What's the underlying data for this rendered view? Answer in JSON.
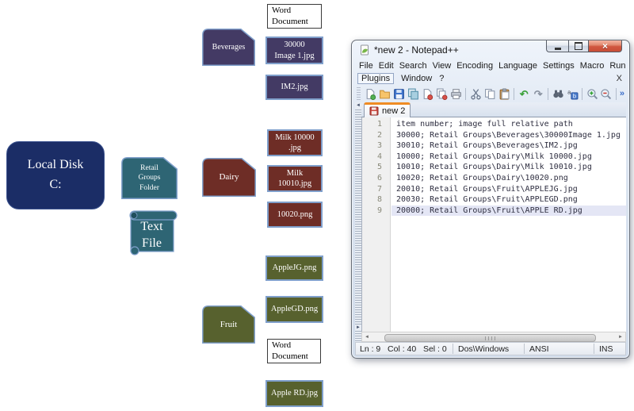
{
  "colors": {
    "root_navy": "#1b2d66",
    "teal": "#2e6574",
    "beverages_purple": "#433a64",
    "dairy_maroon": "#6e2d26",
    "fruit_olive": "#57612e",
    "filebox_border": "#7f9fcb",
    "tab_accent_orange": "#ef8b24",
    "current_line_highlight": "#e4e6f5",
    "close_button_red": "#c84e37"
  },
  "diagram": {
    "local_disk": "Local Disk\nC:",
    "retail_folder": "Retail\nGroups\nFolder",
    "text_file": "Text\nFile",
    "beverages": {
      "label": "Beverages",
      "doc": "Word\nDocument",
      "img1": "30000\nImage 1.jpg",
      "img2": "IM2.jpg"
    },
    "dairy": {
      "label": "Dairy",
      "img1": "Milk 10000\n.jpg",
      "img2": "Milk\n10010.jpg",
      "img3": "10020.png"
    },
    "fruit": {
      "label": "Fruit",
      "img1": "AppleJG.png",
      "img2": "AppleGD.png",
      "doc": "Word\nDocument",
      "img3": "Apple RD.jpg"
    }
  },
  "notepad": {
    "title": "*new 2 - Notepad++",
    "menu_row1": [
      "File",
      "Edit",
      "Search",
      "View",
      "Encoding",
      "Language",
      "Settings",
      "Macro",
      "Run"
    ],
    "menu_row2": [
      "Plugins",
      "Window",
      "?"
    ],
    "menu_close": "X",
    "toolbar_icons": [
      "new-file",
      "open-folder",
      "save",
      "save-all",
      "close-file",
      "close-all-files",
      "print",
      "cut",
      "copy",
      "paste",
      "undo",
      "redo",
      "find",
      "replace",
      "zoom-in",
      "zoom-out"
    ],
    "toolbar_overflow": "»",
    "tab": "new 2",
    "lines": [
      {
        "num": "1",
        "text": "item number; image full relative path"
      },
      {
        "num": "2",
        "text": "30000; Retail Groups\\Beverages\\30000Image 1.jpg"
      },
      {
        "num": "3",
        "text": "30010; Retail Groups\\Beverages\\IM2.jpg"
      },
      {
        "num": "4",
        "text": "10000; Retail Groups\\Dairy\\Milk 10000.jpg"
      },
      {
        "num": "5",
        "text": "10010; Retail Groups\\Dairy\\Milk 10010.jpg"
      },
      {
        "num": "6",
        "text": "10020; Retail Groups\\Dairy\\10020.png"
      },
      {
        "num": "7",
        "text": "20010; Retail Groups\\Fruit\\APPLEJG.jpg"
      },
      {
        "num": "8",
        "text": "20030; Retail Groups\\Fruit\\APPLEGD.png"
      },
      {
        "num": "9",
        "text": "20000; Retail Groups\\Fruit\\APPLE RD.jpg"
      }
    ],
    "status": {
      "position": "Ln : 9   Col : 40   Sel : 0",
      "eol": "Dos\\Windows",
      "encoding": "ANSI",
      "mode": "INS"
    }
  }
}
